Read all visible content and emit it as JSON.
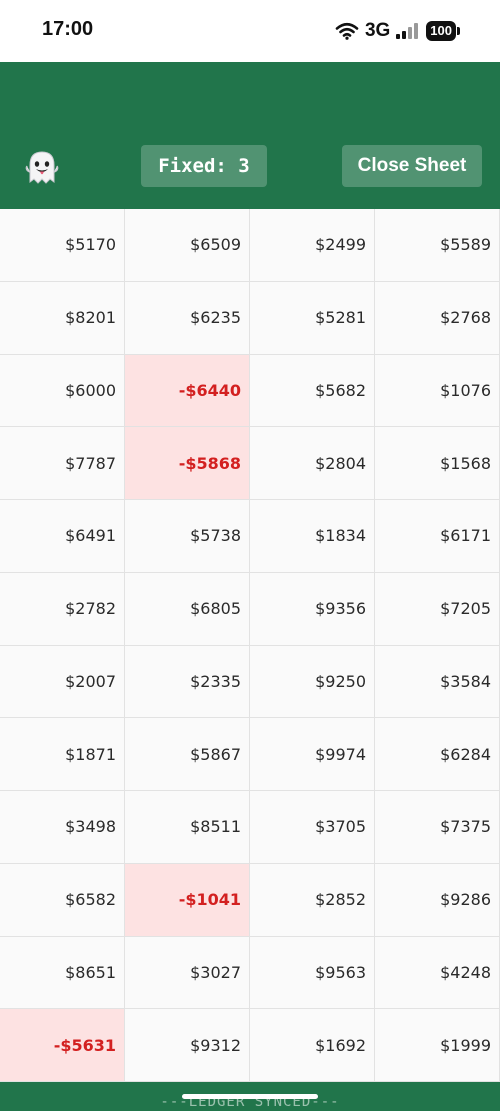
{
  "status_bar": {
    "time": "17:00",
    "network": "3G",
    "battery": "100"
  },
  "header": {
    "mascot_icon": "ghost-icon",
    "fixed_label": "Fixed: 3",
    "close_label": "Close Sheet",
    "background_color": "#21754b"
  },
  "sheet": {
    "rows": [
      [
        "$5170",
        "$6509",
        "$2499",
        "$5589"
      ],
      [
        "$8201",
        "$6235",
        "$5281",
        "$2768"
      ],
      [
        "$6000",
        "-$6440",
        "$5682",
        "$1076"
      ],
      [
        "$7787",
        "-$5868",
        "$2804",
        "$1568"
      ],
      [
        "$6491",
        "$5738",
        "$1834",
        "$6171"
      ],
      [
        "$2782",
        "$6805",
        "$9356",
        "$7205"
      ],
      [
        "$2007",
        "$2335",
        "$9250",
        "$3584"
      ],
      [
        "$1871",
        "$5867",
        "$9974",
        "$6284"
      ],
      [
        "$3498",
        "$8511",
        "$3705",
        "$7375"
      ],
      [
        "$6582",
        "-$1041",
        "$2852",
        "$9286"
      ],
      [
        "$8651",
        "$3027",
        "$9563",
        "$4248"
      ],
      [
        "-$5631",
        "$9312",
        "$1692",
        "$1999"
      ]
    ],
    "negative_color": "#d32020",
    "negative_bg": "#fde2e2"
  },
  "footer": {
    "text": "---LEDGER SYNCED---"
  }
}
